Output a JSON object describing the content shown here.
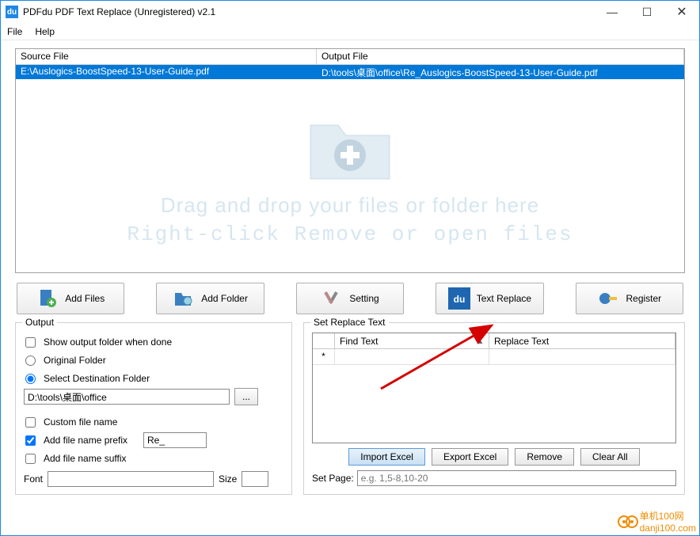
{
  "window": {
    "title": "PDFdu PDF Text Replace (Unregistered) v2.1",
    "app_icon_text": "du"
  },
  "menu": {
    "file": "File",
    "help": "Help"
  },
  "grid": {
    "col_source": "Source File",
    "col_output": "Output File",
    "rows": [
      {
        "source": "E:\\Auslogics-BoostSpeed-13-User-Guide.pdf",
        "output": "D:\\tools\\桌面\\office\\Re_Auslogics-BoostSpeed-13-User-Guide.pdf"
      }
    ],
    "hint_line1": "Drag and drop your files or folder here",
    "hint_line2": "Right-click Remove or open files"
  },
  "buttons": {
    "add_files": "Add Files",
    "add_folder": "Add Folder",
    "setting": "Setting",
    "text_replace": "Text Replace",
    "register": "Register"
  },
  "output": {
    "legend": "Output",
    "show_folder": "Show output folder when done",
    "original_folder": "Original Folder",
    "select_dest": "Select Destination Folder",
    "dest_path": "D:\\tools\\桌面\\office",
    "browse": "...",
    "custom_name": "Custom file name",
    "prefix_label": "Add file name prefix",
    "prefix_value": "Re_",
    "suffix_label": "Add file name suffix",
    "font_label": "Font",
    "size_label": "Size"
  },
  "replace": {
    "legend": "Set Replace Text",
    "col_find": "Find Text",
    "col_replace": "Replace Text",
    "row_marker": "*",
    "import": "Import Excel",
    "export": "Export Excel",
    "remove": "Remove",
    "clear": "Clear All",
    "setpage_label": "Set Page:",
    "setpage_hint": "e.g. 1,5-8,10-20"
  },
  "watermark": {
    "name": "单机100网",
    "url": "danji100.com"
  }
}
